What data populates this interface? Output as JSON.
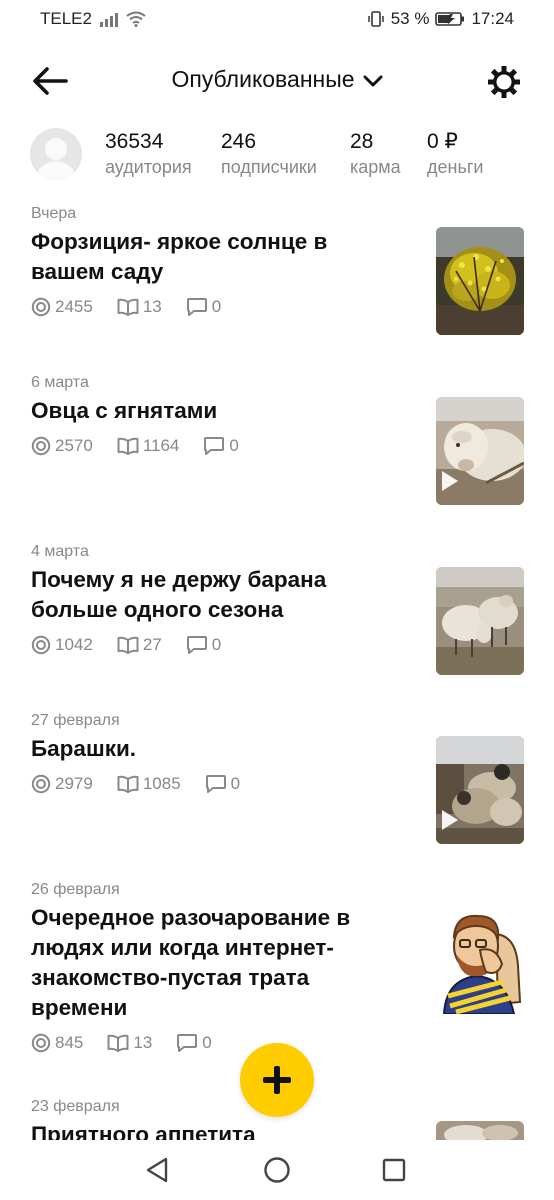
{
  "status_bar": {
    "carrier": "TELE2",
    "battery": "53 %",
    "time": "17:24"
  },
  "header": {
    "title": "Опубликованные"
  },
  "stats": [
    {
      "value": "36534",
      "label": "аудитория"
    },
    {
      "value": "246",
      "label": "подписчики"
    },
    {
      "value": "28",
      "label": "карма"
    },
    {
      "value": "0 ₽",
      "label": "деньги"
    }
  ],
  "articles": [
    {
      "date": "Вчера",
      "title": "Форзиция- яркое солнце в вашем саду",
      "views": "2455",
      "reads": "13",
      "comments": "0",
      "video": false
    },
    {
      "date": "6 марта",
      "title": "Овца с ягнятами",
      "views": "2570",
      "reads": "1164",
      "comments": "0",
      "video": true
    },
    {
      "date": "4 марта",
      "title": "Почему я не держу барана больше одного сезона",
      "views": "1042",
      "reads": "27",
      "comments": "0",
      "video": false
    },
    {
      "date": "27 февраля",
      "title": "Барашки.",
      "views": "2979",
      "reads": "1085",
      "comments": "0",
      "video": true
    },
    {
      "date": "26 февраля",
      "title": "Очередное разочарование в людях или когда интернет-знакомство-пустая трата времени",
      "views": "845",
      "reads": "13",
      "comments": "0",
      "video": false
    },
    {
      "date": "23 февраля",
      "title": "Приятного аппетита",
      "views": "",
      "reads": "",
      "comments": "",
      "video": false
    }
  ],
  "colors": {
    "accent": "#ffcc00",
    "muted_text": "#888888",
    "icon_gray": "#888888"
  }
}
